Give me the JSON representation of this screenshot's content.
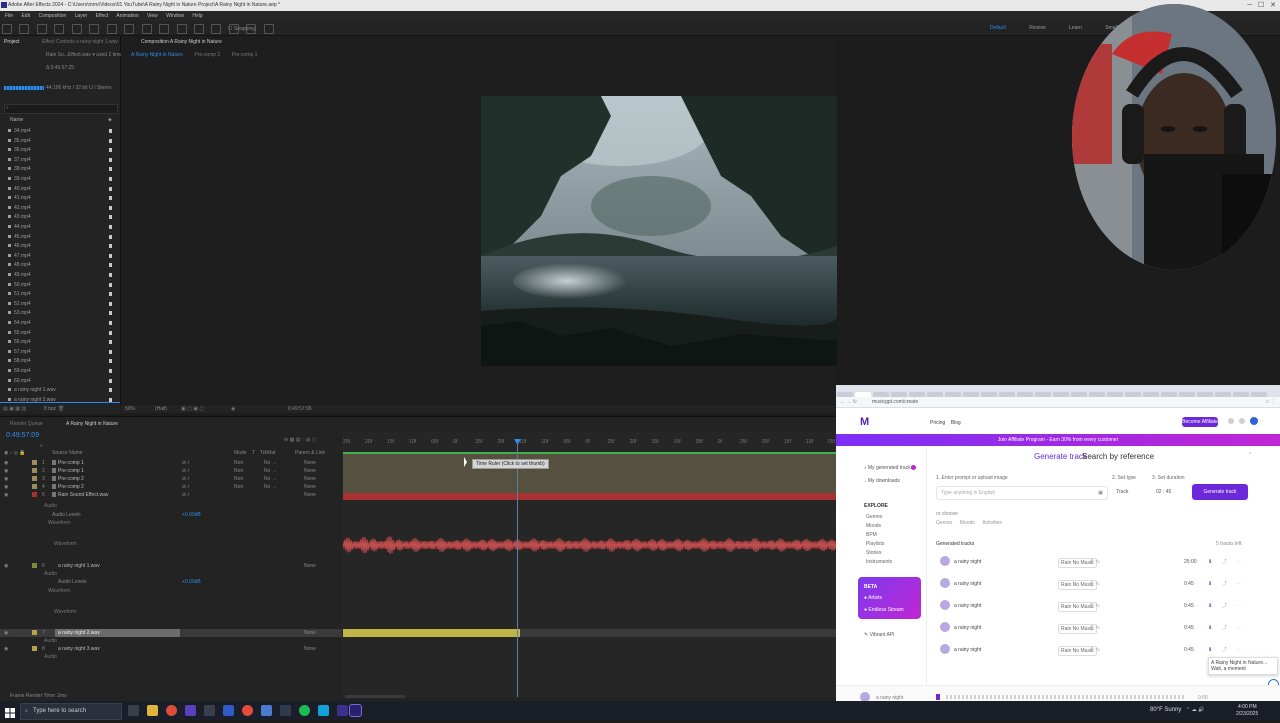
{
  "window": {
    "title": "Adobe After Effects 2024 - C:\\Users\\mrre\\Videos\\01 YouTube\\A Rainy Night in Nature Project\\A Rainy Night in Nature.aep *"
  },
  "menu": [
    "File",
    "Edit",
    "Composition",
    "Layer",
    "Effect",
    "Animation",
    "View",
    "Window",
    "Help"
  ],
  "toolbar": {
    "snapping_label": "Snapping"
  },
  "workspaces": [
    "Default",
    "Review",
    "Learn",
    "Small Screen"
  ],
  "project": {
    "tabs": [
      "Project",
      "Effect Controls a rainy night 1.wav"
    ],
    "info_line1": "Rain So...Effect.wav ▾ used 2 times",
    "info_line2": "Δ 0:49:57:25",
    "info_line3": "44.100 kHz / 32 bit U / Stereo",
    "files": [
      "34.mp4",
      "35.mp4",
      "36.mp4",
      "37.mp4",
      "38.mp4",
      "39.mp4",
      "40.mp4",
      "41.mp4",
      "42.mp4",
      "43.mp4",
      "44.mp4",
      "45.mp4",
      "46.mp4",
      "47.mp4",
      "48.mp4",
      "49.mp4",
      "50.mp4",
      "51.mp4",
      "52.mp4",
      "53.mp4",
      "54.mp4",
      "55.mp4",
      "56.mp4",
      "57.mp4",
      "58.mp4",
      "59.mp4",
      "60.mp4",
      "a rainy night 1.wav",
      "a rainy night 2.wav"
    ],
    "footer_bpc": "8 bpc"
  },
  "composition": {
    "tab_label": "Composition A Rainy Night in Nature",
    "breadcrumbs": [
      "A Rainy Night in Nature",
      "Pre-comp 2",
      "Pre-comp 1"
    ],
    "zoom": "50%",
    "quality": "(Half)",
    "timecode": "0:49:57:06"
  },
  "timeline": {
    "tabs": [
      "Render Queue",
      "A Rainy Night in Nature"
    ],
    "timecode": "0:49:57:09",
    "columns": [
      "Source Name",
      "Mode",
      "T",
      "TrkMat",
      "Parent & Link"
    ],
    "layers": [
      {
        "num": "1",
        "name": "Pre-comp 1",
        "mode": "Norr",
        "trk": "No →",
        "parent": "None"
      },
      {
        "num": "2",
        "name": "Pre-comp 1",
        "mode": "Norr",
        "trk": "No →",
        "parent": "None"
      },
      {
        "num": "3",
        "name": "Pre-comp 2",
        "mode": "Norr",
        "trk": "No →",
        "parent": "None"
      },
      {
        "num": "4",
        "name": "Pre-comp 2",
        "mode": "Norr",
        "trk": "No →",
        "parent": "None"
      },
      {
        "num": "5",
        "name": "Rain Sound Effect.wav",
        "mode": "",
        "trk": "",
        "parent": "None"
      }
    ],
    "sub_audio": "Audio",
    "sub_audio_levels": "Audio Levels",
    "audio_levels_value": "+0.00dB",
    "sub_waveform": "Waveform",
    "layer6": {
      "num": "6",
      "name": "a rainy night 1.wav",
      "parent": "None"
    },
    "audio_levels_value2": "+0.00dB",
    "layer7": {
      "num": "7",
      "name": "a rainy night 2.wav",
      "parent": "None"
    },
    "layer8": {
      "num": "8",
      "name": "a rainy night 3.wav",
      "parent": "None"
    },
    "tooltip": "Time Ruler (Click to set thumb)",
    "frame_render_time": "Frame Render Time: 2ms",
    "ruler_ticks": [
      "25f",
      "20f",
      "15f",
      "10f",
      "05f",
      "0f",
      "25f",
      "20f",
      "15f",
      "10f",
      "05f",
      "0f",
      "25f",
      "20f",
      "15f",
      "10f",
      "05f",
      "0f",
      "25f",
      "20f",
      "15f",
      "10f",
      "05f"
    ]
  },
  "browser": {
    "url": "musicgpt.com/create",
    "logo": "M",
    "nav": [
      "Pricing",
      "Blog"
    ],
    "cta": "Become Affiliate",
    "promo": "Join Affiliate Program - Earn 30% from every customer",
    "sidebar": {
      "items": [
        "My generated tracks",
        "My downloads"
      ],
      "explore_heading": "EXPLORE",
      "explore": [
        "Genres",
        "Moods",
        "BPM",
        "Playlists",
        "Stories",
        "Instruments"
      ],
      "beta_heading": "BETA",
      "beta_items": [
        "Artists",
        "Endless Stream"
      ],
      "extra": "Vibrant API"
    },
    "tabs": [
      "Generate track",
      "Search by reference"
    ],
    "steps": [
      "1. Enter prompt or upload image",
      "2. Set type",
      "3. Set duration"
    ],
    "prompt_placeholder": "Type anything in English",
    "type_value": "Track",
    "duration_value": "02 : 45",
    "generate_button": "Generate track",
    "chips_label": "or choose",
    "chips": [
      "Genres",
      "Moods",
      "Activities"
    ],
    "generated_heading": "Generated tracks",
    "generated_count": "5 tracks left",
    "tracks": [
      {
        "title": "a rainy night",
        "tag": "Rain No Music",
        "duration": "25:00"
      },
      {
        "title": "a rainy night",
        "tag": "Rain No Music",
        "duration": "0:45"
      },
      {
        "title": "a rainy night",
        "tag": "Rain No Music",
        "duration": "0:45"
      },
      {
        "title": "a rainy night",
        "tag": "Rain No Music",
        "duration": "0:45"
      },
      {
        "title": "a rainy night",
        "tag": "Rain No Music",
        "duration": "0:45"
      }
    ],
    "toast": "A Rainy Night in Nature... Wait, a moment",
    "player_title": "a rainy night",
    "player_time": "0:00"
  },
  "taskbar": {
    "search_placeholder": "Type here to search",
    "weather": "80°F Sunny",
    "clock_time": "4:00 PM",
    "clock_date": "2/23/2025"
  },
  "colors": {
    "ae_blue": "#2d8ceb",
    "audio_red": "#a83232",
    "precomp_tan": "#55513e",
    "purple": "#6d28d9"
  }
}
